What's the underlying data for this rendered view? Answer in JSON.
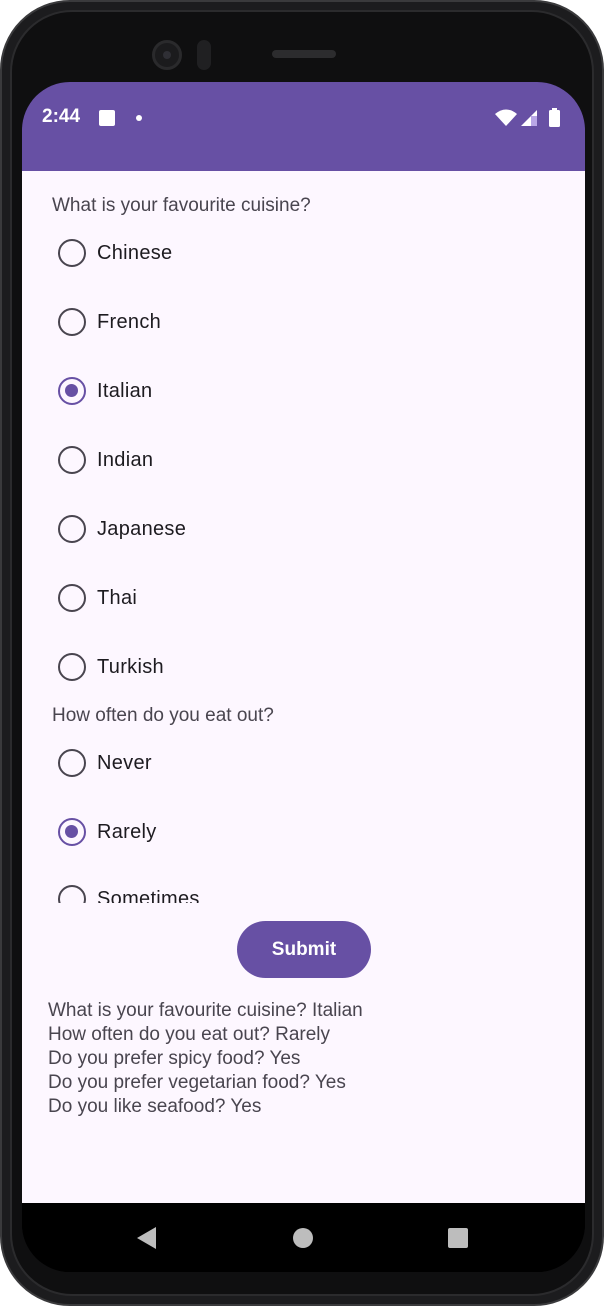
{
  "status_bar": {
    "time": "2:44",
    "notification_icon": "square-icon",
    "dot_icon": "dot-icon",
    "icons": [
      "wifi-icon",
      "signal-icon",
      "battery-icon"
    ],
    "background": "#6750a4"
  },
  "survey": {
    "question1": {
      "text": "What is your favourite cuisine?",
      "options": [
        "Chinese",
        "French",
        "Italian",
        "Indian",
        "Japanese",
        "Thai",
        "Turkish"
      ],
      "selected": "Italian"
    },
    "question2": {
      "text": "How often do you eat out?",
      "options": [
        "Never",
        "Rarely",
        "Sometimes"
      ],
      "selected": "Rarely"
    }
  },
  "submit_label": "Submit",
  "results": [
    "What is your favourite cuisine? Italian",
    "How often do you eat out? Rarely",
    "Do you prefer spicy food? Yes",
    "Do you prefer vegetarian food? Yes",
    "Do you like seafood? Yes"
  ],
  "nav_bar": {
    "icons": [
      "back-icon",
      "home-icon",
      "recents-icon"
    ]
  },
  "colors": {
    "accent": "#6750a4",
    "background": "#fdf7ff",
    "text": "#49454f"
  }
}
